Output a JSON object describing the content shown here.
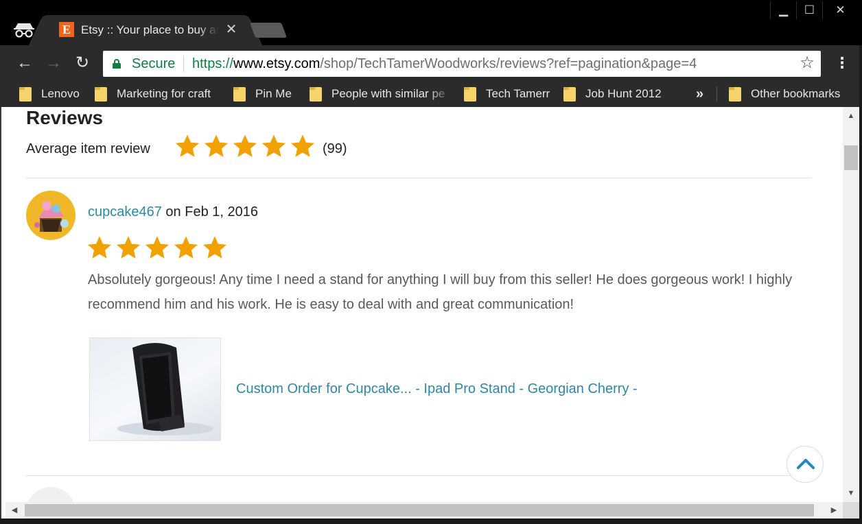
{
  "browser": {
    "tab": {
      "favicon_letter": "E",
      "title": "Etsy :: Your place to buy and sell all things handmade",
      "close_glyph": "✕"
    },
    "window_controls": {
      "minimize": "▁",
      "maximize": "☐",
      "close": "✕"
    },
    "nav": {
      "back": "←",
      "forward": "→",
      "reload": "↻",
      "menu": "⋮"
    },
    "omnibox": {
      "secure_label": "Secure",
      "url_scheme": "https://",
      "url_host": "www.etsy.com",
      "url_path": "/shop/TechTamerWoodworks/reviews?ref=pagination&page=4",
      "star_glyph": "☆"
    },
    "bookmarks": [
      {
        "label": "Lenovo"
      },
      {
        "label": "Marketing for craft"
      },
      {
        "label": "Pin Me"
      },
      {
        "label": "People with similar pe"
      },
      {
        "label": "Tech Tamerr"
      },
      {
        "label": "Job Hunt 2012"
      }
    ],
    "bookmarks_more": "»",
    "other_bookmarks": "Other bookmarks"
  },
  "page": {
    "heading": "Reviews",
    "average_label": "Average item review",
    "average_rating": 5,
    "review_count": "(99)",
    "review": {
      "username": "cupcake467",
      "date_text": " on Feb 1, 2016",
      "rating": 5,
      "text": "Absolutely gorgeous! Any time I need a stand for anything I will buy from this seller! He does gorgeous work! I highly recommend him and his work. He is easy to deal with and great communication!",
      "listing_title": "Custom Order for Cupcake... - Ipad Pro Stand - Georgian Cherry -"
    }
  },
  "scrollbars": {
    "up": "▲",
    "down": "▼",
    "left": "◀",
    "right": "▶"
  },
  "colors": {
    "star": "#f1a102",
    "link": "#2a89a8",
    "secure": "#0b8043",
    "etsy_orange": "#f1641e"
  }
}
